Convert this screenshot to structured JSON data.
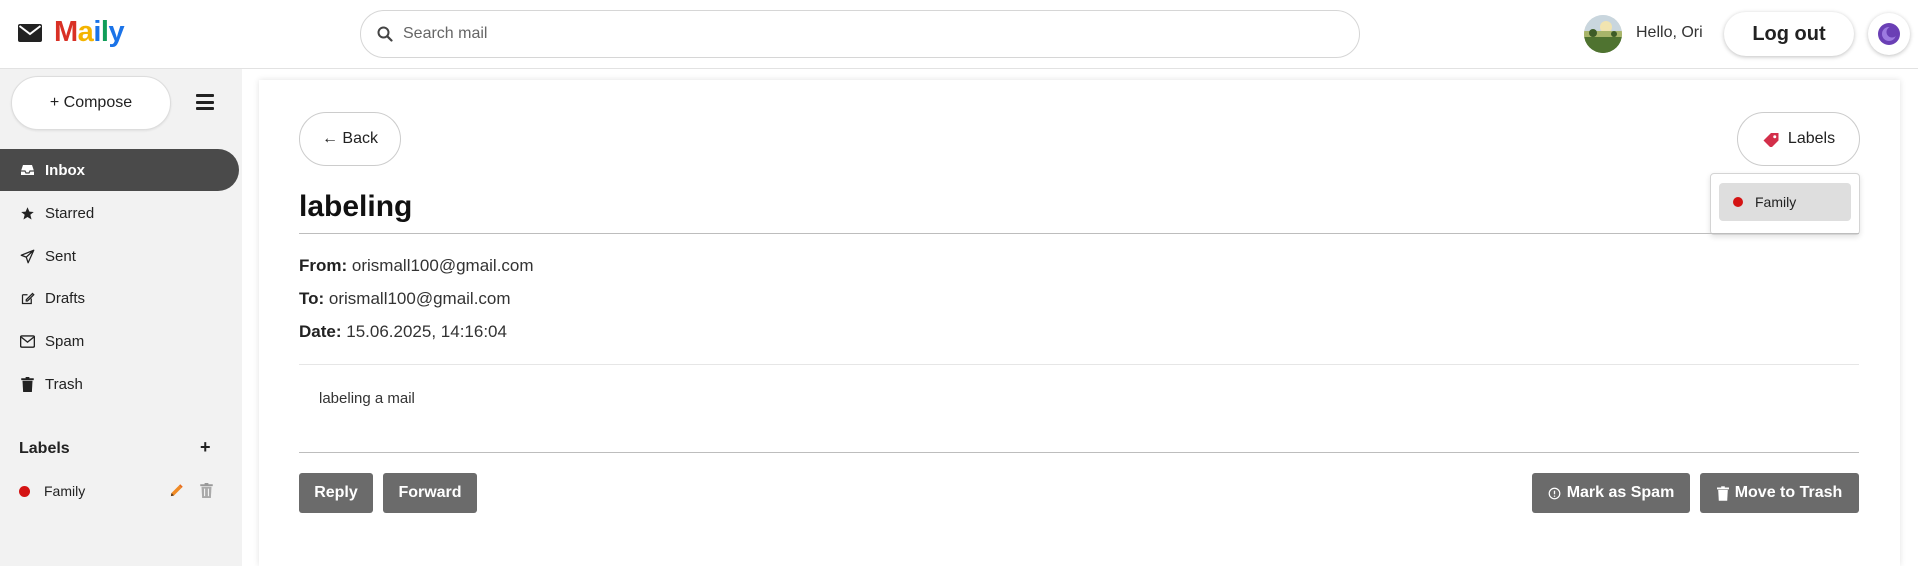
{
  "app": {
    "name": "Maily",
    "logo_letters": [
      {
        "char": "M",
        "color": "#d93025"
      },
      {
        "char": "a",
        "color": "#f4b400"
      },
      {
        "char": "i",
        "color": "#1a73e8"
      },
      {
        "char": "l",
        "color": "#0f9d58"
      },
      {
        "char": "y",
        "color": "#1a73e8"
      }
    ]
  },
  "header": {
    "search_placeholder": "Search mail",
    "greeting": "Hello, Ori",
    "logout_label": "Log out"
  },
  "sidebar": {
    "compose_label": "+ Compose",
    "items": [
      {
        "label": "Inbox",
        "icon": "inbox-icon",
        "active": true
      },
      {
        "label": "Starred",
        "icon": "star-icon",
        "active": false
      },
      {
        "label": "Sent",
        "icon": "send-icon",
        "active": false
      },
      {
        "label": "Drafts",
        "icon": "drafts-icon",
        "active": false
      },
      {
        "label": "Spam",
        "icon": "spam-icon",
        "active": false
      },
      {
        "label": "Trash",
        "icon": "trash-icon",
        "active": false
      }
    ],
    "labels_heading": "Labels",
    "labels_add": "+",
    "labels": [
      {
        "name": "Family",
        "color": "#d41313"
      }
    ]
  },
  "mail": {
    "back_label": "← Back",
    "labels_button": "Labels",
    "dropdown_labels": [
      {
        "name": "Family",
        "color": "#d41313"
      }
    ],
    "subject": "labeling",
    "from_label": "From:",
    "from": "orismall100@gmail.com",
    "to_label": "To:",
    "to": "orismall100@gmail.com",
    "date_label": "Date:",
    "date": "15.06.2025, 14:16:04",
    "body": "labeling a mail",
    "actions": {
      "reply": "Reply",
      "forward": "Forward",
      "spam": "Mark as Spam",
      "trash": "Move to Trash"
    }
  },
  "colors": {
    "active_nav": "#4a4a4a",
    "action_button": "#6b6b6b",
    "label_red": "#d41313"
  }
}
